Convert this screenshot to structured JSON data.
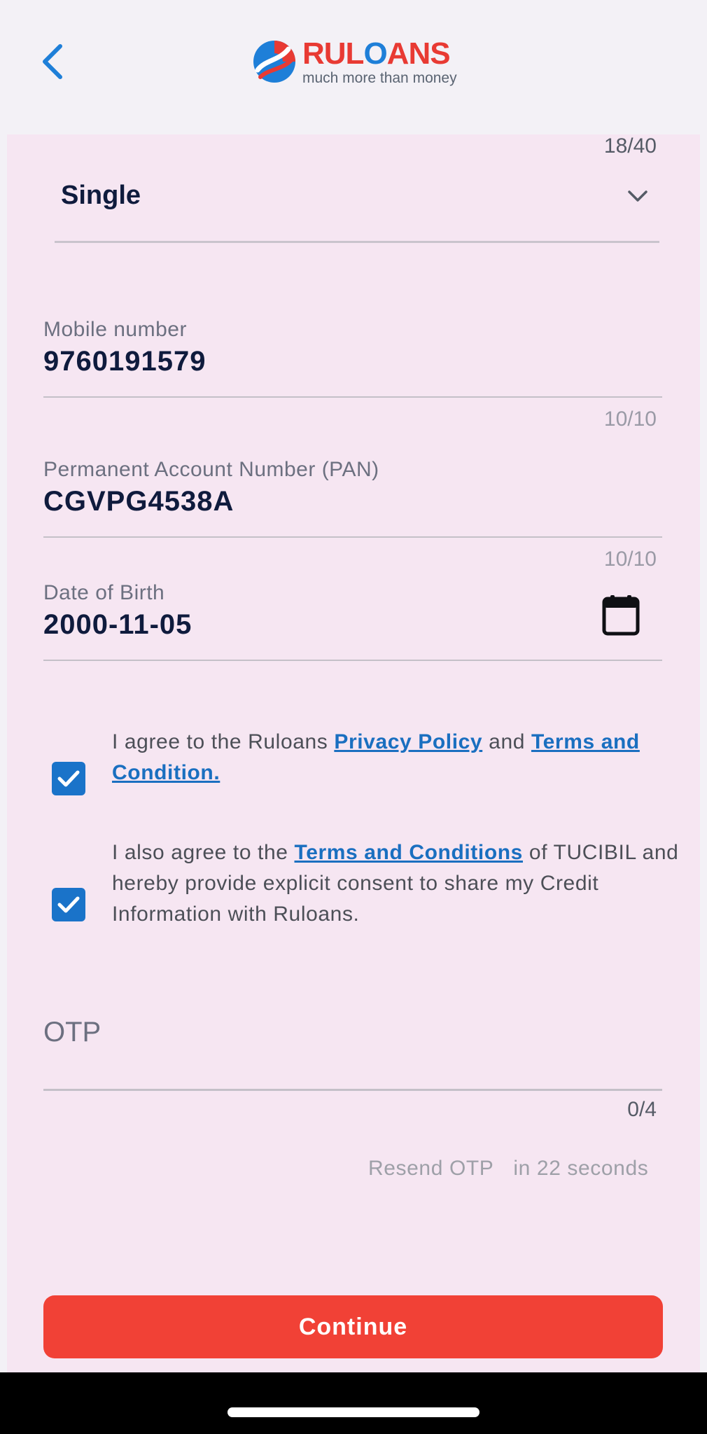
{
  "header": {
    "brand_name_part1": "RUL",
    "brand_name_o": "O",
    "brand_name_part2": "ANS",
    "tagline": "much more than money"
  },
  "form": {
    "marital_status": {
      "value": "Single",
      "counter": "18/40"
    },
    "mobile": {
      "label": "Mobile number",
      "value": "9760191579",
      "counter": "10/10"
    },
    "pan": {
      "label": "Permanent Account Number (PAN)",
      "value": "CGVPG4538A",
      "counter": "10/10"
    },
    "dob": {
      "label": "Date of Birth",
      "value": "2000-11-05"
    },
    "consent1": {
      "checked": true,
      "prefix": "I agree to the Ruloans ",
      "link1": "Privacy Policy",
      "middle": " and ",
      "link2": "Terms and Condition."
    },
    "consent2": {
      "checked": true,
      "prefix": "I also agree to the ",
      "link": "Terms and Conditions",
      "suffix": " of TUCIBIL and hereby provide explicit consent to share my Credit Information with Ruloans."
    },
    "otp": {
      "placeholder": "OTP",
      "counter": "0/4"
    },
    "resend": {
      "label": "Resend OTP",
      "timer": "in 22 seconds"
    },
    "continue_label": "Continue"
  },
  "colors": {
    "accent": "#1a73c9",
    "primary_button": "#f14136",
    "card_bg": "#f6e6f2",
    "header_bg": "#f3f1f6"
  }
}
